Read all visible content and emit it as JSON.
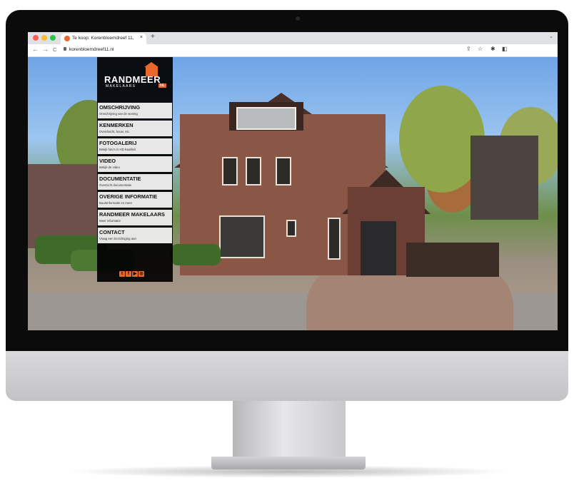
{
  "browser": {
    "tab_title": "Te koop: Korenbloemdreef 11,",
    "tab_close": "×",
    "new_tab": "+",
    "tabs_menu": "⌄",
    "back": "←",
    "forward": "→",
    "reload": "C",
    "url": "korenbloemdreef11.nl",
    "toolbar_icons": [
      "share-icon",
      "star-icon",
      "extensions-icon",
      "sidebar-icon"
    ]
  },
  "logo": {
    "name": "RANDMEER",
    "sub": "MAKELAARS",
    "badge": "NL"
  },
  "menu": [
    {
      "label": "OMSCHRIJVING",
      "sub": "Omschrijving van de woning"
    },
    {
      "label": "KENMERKEN",
      "sub": "Overdracht, bouw, etc."
    },
    {
      "label": "FOTOGALERIJ",
      "sub": "Bekijk foto's in HD kwaliteit"
    },
    {
      "label": "VIDEO",
      "sub": "Bekijk de video"
    },
    {
      "label": "DOCUMENTATIE",
      "sub": "Overzicht documentatie"
    },
    {
      "label": "OVERIGE INFORMATIE",
      "sub": "Buurtinformatie en meer"
    },
    {
      "label": "RANDMEER MAKELAARS",
      "sub": "Meer informatie"
    },
    {
      "label": "CONTACT",
      "sub": "Vraag een bezichtiging aan"
    }
  ],
  "social": [
    "twitter-icon",
    "facebook-icon",
    "youtube-icon",
    "instagram-icon"
  ],
  "colors": {
    "accent": "#e8672b",
    "sidebar": "#000000",
    "bezel": "#0b0b0b"
  }
}
